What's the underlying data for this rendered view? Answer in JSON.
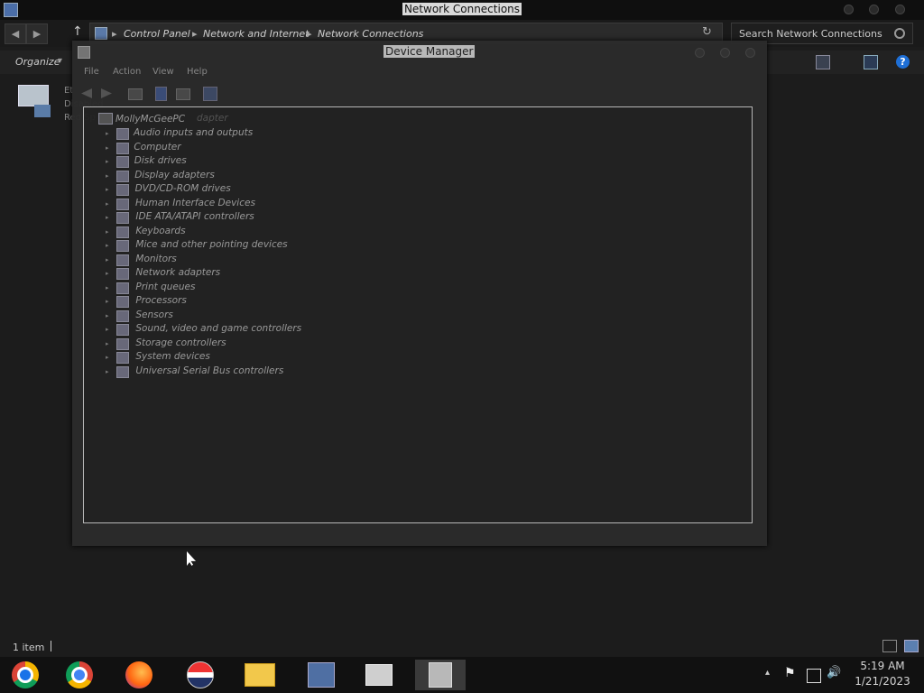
{
  "window": {
    "title": "Network Connections",
    "breadcrumb": [
      "Control Panel",
      "Network and Internet",
      "Network Connections"
    ],
    "search_placeholder": "Search Network Connections",
    "organize_label": "Organize",
    "organize_arrow": "▾",
    "nav_back": "◀",
    "nav_forward": "▶",
    "nav_up": "↑",
    "refresh": "↻",
    "chevron": "▸",
    "status": "1 item",
    "item_peek": {
      "name": "Et",
      "status": "Disabled",
      "device": "Red Sp"
    }
  },
  "device_manager": {
    "title": "Device Manager",
    "menu": [
      "File",
      "Action",
      "View",
      "Help"
    ],
    "root": "MollyMcGeePC",
    "root_ghost": "dapter",
    "categories": [
      "Audio inputs and outputs",
      "Computer",
      "Disk drives",
      "Display adapters",
      "DVD/CD-ROM drives",
      "Human Interface Devices",
      "IDE ATA/ATAPI controllers",
      "Keyboards",
      "Mice and other pointing devices",
      "Monitors",
      "Network adapters",
      "Print queues",
      "Processors",
      "Sensors",
      "Sound, video and game controllers",
      "Storage controllers",
      "System devices",
      "Universal Serial Bus controllers"
    ],
    "expand_glyph": "▸"
  },
  "taskbar": {
    "apps": [
      "chrome-canary-icon",
      "chrome-icon",
      "firefox-icon",
      "opera-icon",
      "file-explorer-icon",
      "control-panel-icon",
      "archive-icon",
      "device-manager-icon"
    ],
    "time": "5:19 AM",
    "date": "1/21/2023",
    "tray_expand": "▴",
    "flag_glyph": "⚑",
    "speaker_glyph": "🔊"
  },
  "colors": {
    "accent": "#1e6fd6",
    "background": "#1c1c1c"
  }
}
